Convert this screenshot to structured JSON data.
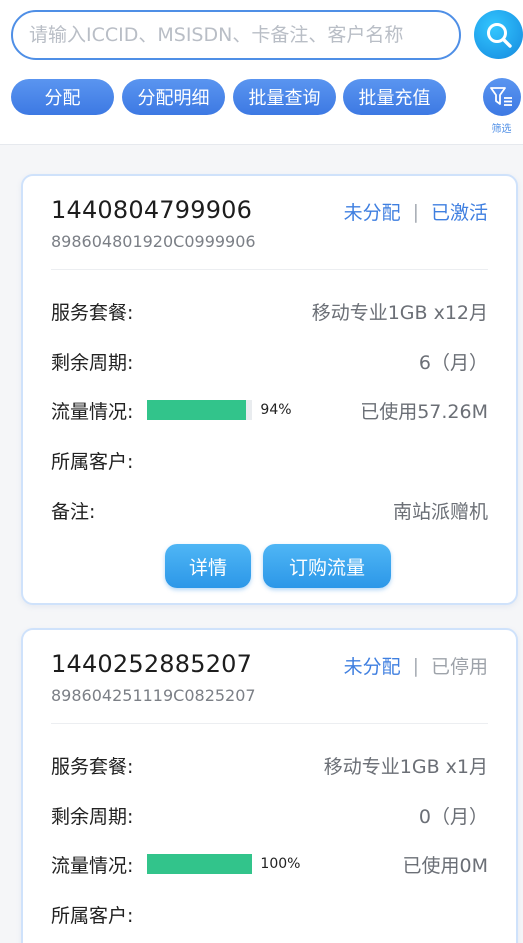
{
  "search": {
    "placeholder": "请输入ICCID、MSISDN、卡备注、客户名称"
  },
  "actions": [
    {
      "label": "分配"
    },
    {
      "label": "分配明细"
    },
    {
      "label": "批量查询"
    },
    {
      "label": "批量充值"
    }
  ],
  "filter": {
    "label": "筛选"
  },
  "field_labels": {
    "plan": "服务套餐:",
    "cycle": "剩余周期:",
    "usage": "流量情况:",
    "customer": "所属客户:",
    "remark": "备注:"
  },
  "cards": [
    {
      "msisdn": "1440804799906",
      "iccid": "898604801920C0999906",
      "assign_status": "未分配",
      "separator": "|",
      "activation_status": "已激活",
      "plan": "移动专业1GB x12月",
      "cycle": "6（月）",
      "usage_percent": 94,
      "usage_percent_label": "94%",
      "usage_used": "已使用57.26M",
      "customer": "",
      "remark": "南站派赠机",
      "detail_button": "详情",
      "order_button": "订购流量"
    },
    {
      "msisdn": "1440252885207",
      "iccid": "898604251119C0825207",
      "assign_status": "未分配",
      "separator": "|",
      "activation_status": "已停用",
      "plan": "移动专业1GB x1月",
      "cycle": "0（月）",
      "usage_percent": 100,
      "usage_percent_label": "100%",
      "usage_used": "已使用0M",
      "customer": ""
    }
  ],
  "colors": {
    "accent": "#3f7fe0",
    "progress": "#32c48b",
    "status_inactive": "#9ea3aa"
  }
}
